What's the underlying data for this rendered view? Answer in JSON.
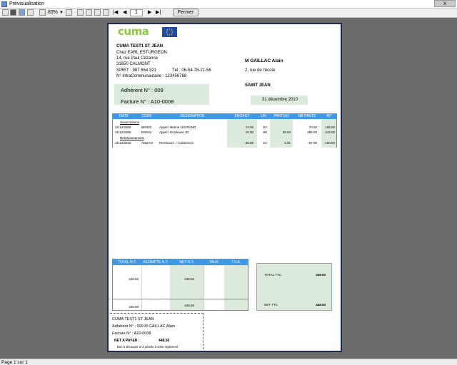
{
  "window": {
    "title": "Prévisualisation",
    "close_glyph": "x"
  },
  "toolbar": {
    "icons": [
      "print-icon",
      "save-icon",
      "binoculars-icon",
      "open-icon",
      "zoom-out-icon",
      "single-page-icon",
      "two-pages-icon",
      "four-pages-icon",
      "edit-icon"
    ],
    "zoom": "83%",
    "first_page_glyph": "|◀",
    "prev_page_glyph": "◀",
    "current_page": "1",
    "next_page_glyph": "▶",
    "last_page_glyph": "▶|",
    "close_button": "Fermer"
  },
  "status": {
    "page_info": "Page 1 sur 1"
  },
  "invoice": {
    "logo_text": "cuma",
    "issuer": {
      "name": "CUMA  TEST1  ST JEAN",
      "care_of": "Chez EARL ESTURGEON",
      "street": "14, rue Paul Cézanne",
      "city": "31650  CALMONT",
      "siret": "SIRET : 987 654 321",
      "phone": "Tél :  06-54-78-21-56",
      "vat": "N° IntraCommunautaire : 123456788"
    },
    "recipient": {
      "name": "M GAILLAC Alain",
      "street": "2, rue de l'école",
      "city": "SAINT JEAN"
    },
    "member_no": "Adhérent N° : 009",
    "invoice_no": "Facture N° : A10-0008",
    "date": "31 décembre 2010",
    "columns": [
      "DATE",
      "CODE",
      "DESIGNATION",
      "ENGAGT",
      "UN",
      "PARTS/U",
      "NB PARTS",
      "MT"
    ],
    "sections": [
      {
        "title": "Souscriptions",
        "rows": [
          {
            "date": "31/12/2009",
            "code": "BEN02",
            "designation": "Appel / Benne LEGRAND",
            "engagt": "14.00",
            "un": "JO",
            "parts_u": "",
            "nb_parts": "70.00",
            "mt": "105.00"
          },
          {
            "date": "31/12/2009",
            "code": "ENS04",
            "designation": "Appel / Ensileuse JD",
            "engagt": "10.00",
            "un": "HE",
            "parts_u": "29.63",
            "nb_parts": "296.00",
            "mt": "444.00"
          }
        ]
      },
      {
        "title": "Remboursement",
        "rows": [
          {
            "date": "31/12/2010",
            "code": "ANDAN",
            "designation": "Rembours. / Andaineurs",
            "engagt": "-35.08",
            "un": "SA",
            "parts_u": "1.91",
            "nb_parts": "-67.00",
            "mt": "-100.50"
          }
        ]
      }
    ],
    "totals": {
      "headers": [
        "TOTAL H.T.",
        "ACOMPTE H.T.",
        "NET H.T.",
        "TAUX",
        "T.V.A."
      ],
      "total_ht": "448.50",
      "net_ht": "448.50",
      "footer_total_ht": "448.50",
      "footer_net_ht": "448.50"
    },
    "ttc": {
      "total_label": "TOTAL TTC",
      "total_value": "448.50",
      "net_label": "NET TTC",
      "net_value": "448.50"
    },
    "coupon": {
      "issuer": "CUMA  TEST1  ST JEAN",
      "member": "Adhérent N° : 009 M GAILLAC Alain",
      "invoice": "Facture N° : A10-0008",
      "net_label": "NET A PAYER :",
      "net_value": "448.50",
      "note": "Bon à découper et à joindre à votre règlement"
    }
  }
}
